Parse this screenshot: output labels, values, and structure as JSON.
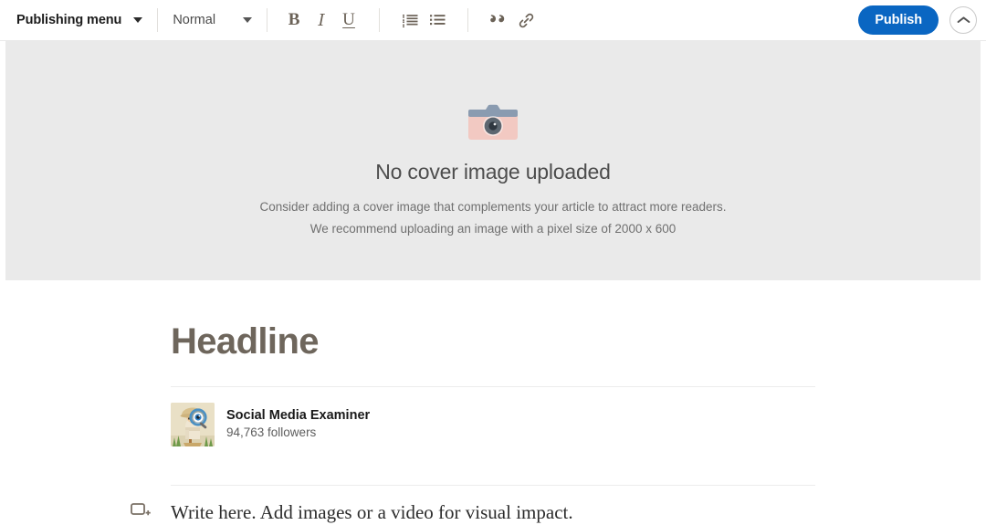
{
  "toolbar": {
    "publishing_menu_label": "Publishing menu",
    "publishing_menu_caret": "chevron-down-icon",
    "text_style_label": "Normal",
    "text_style_caret": "chevron-down-icon",
    "bold_label": "B",
    "italic_label": "I",
    "underline_label": "U",
    "numbered_list_icon": "ordered-list-icon",
    "bulleted_list_icon": "unordered-list-icon",
    "quote_icon": "quote-icon",
    "link_icon": "link-icon",
    "publish_label": "Publish",
    "collapse_icon": "chevron-up-icon",
    "publish_color": "#0a66c2"
  },
  "cover": {
    "icon": "camera-icon",
    "title": "No cover image uploaded",
    "subtitle_line1": "Consider adding a cover image that complements your article to attract more readers.",
    "subtitle_line2": "We recommend uploading an image with a pixel size of 2000 x 600",
    "background_color": "#eaeaea"
  },
  "article": {
    "headline_placeholder": "Headline",
    "author": {
      "avatar_icon": "explorer-mascot-avatar",
      "name": "Social Media Examiner",
      "followers": "94,763 followers"
    },
    "body_placeholder": "Write here. Add images or a video for visual impact.",
    "add_content_icon": "add-media-icon"
  }
}
